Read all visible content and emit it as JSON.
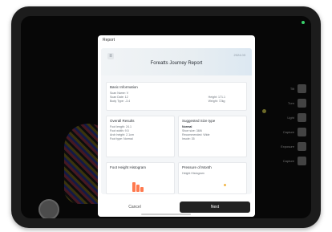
{
  "modal": {
    "header": "Report",
    "report": {
      "date": "2024.03",
      "title": "Foreatts Journey Report",
      "basic_info": {
        "title": "Basic Information",
        "left": [
          "Scan Name: V",
          "Scan Date: 12",
          "Body Type: -3.4"
        ],
        "right": [
          "Height: 171.1",
          "Weight: 72kg"
        ]
      },
      "overall": {
        "title": "Overall Results",
        "lines": [
          "Foot length: 24.1",
          "Foot width: 9.5",
          "Arch height: 2.1cm",
          "Foot type: Normal"
        ]
      },
      "suggested": {
        "title": "Suggested Size type",
        "bold": "Normal",
        "lines": [
          "Shoe size: 38/6",
          "Recommended: Wide",
          "Insole: 35"
        ]
      },
      "foot_height": {
        "title": "Foot Height Histogram"
      },
      "pressure": {
        "title": "Pressure of Month",
        "subtitle": "Height Histogram"
      }
    },
    "footer": {
      "cancel": "Cancel",
      "next": "Next"
    }
  },
  "side_controls": [
    "Tilt",
    "Turn",
    "Light",
    "Capture",
    "Exposure",
    "Capture"
  ],
  "colors": {
    "accent_orange": "#ff7a4f",
    "status_green": "#39d06b",
    "button_dark": "#222222"
  }
}
